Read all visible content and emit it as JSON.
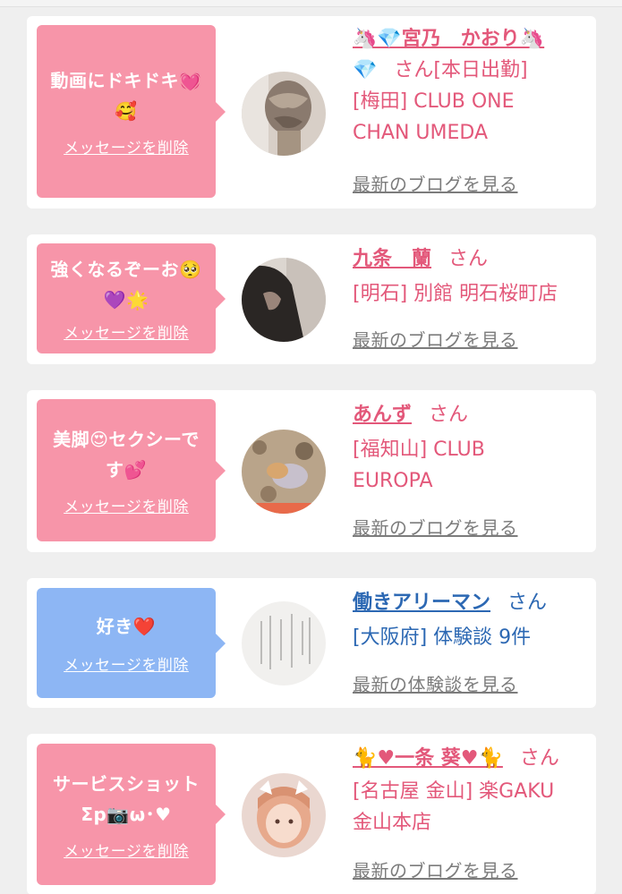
{
  "delete_label": "メッセージを削除",
  "cards": [
    {
      "message_line1": "動画にドキドキ💓",
      "message_line2": "🥰",
      "name": "🦄💎宮乃　かおり🦄",
      "name_line2": "💎",
      "san": "さん[本日出勤]",
      "shop_line1": "[梅田] CLUB ONE",
      "shop_line2": "CHAN UMEDA",
      "link": "最新のブログを見る",
      "bubble_color": "#f795a9"
    },
    {
      "message_line1": "強くなるぞーお🥺",
      "message_line2": "💜🌟",
      "name": "九条　蘭",
      "san": "さん",
      "shop_line1": "[明石] 別館 明石桜町店",
      "link": "最新のブログを見る",
      "bubble_color": "#f795a9"
    },
    {
      "message_line1": "美脚😍セクシーで",
      "message_line2": "す💕",
      "name": "あんず",
      "san": "さん",
      "shop_line1": "[福知山] CLUB",
      "shop_line2": "EUROPA",
      "link": "最新のブログを見る",
      "bubble_color": "#f795a9"
    },
    {
      "message_line1": "好き❤️",
      "name": "働きアリーマン",
      "san": "さん",
      "shop_line1": "[大阪府] 体験談 9件",
      "link": "最新の体験談を見る",
      "bubble_color": "#8db6f4"
    },
    {
      "message_line1": "サービスショット",
      "message_line2": "Σp📷ω･♥",
      "name": "🐈♥一条 葵♥🐈",
      "san": "さん",
      "shop_line1": "[名古屋 金山] 楽GAKU",
      "shop_line2": "金山本店",
      "link": "最新のブログを見る",
      "bubble_color": "#f795a9"
    }
  ]
}
